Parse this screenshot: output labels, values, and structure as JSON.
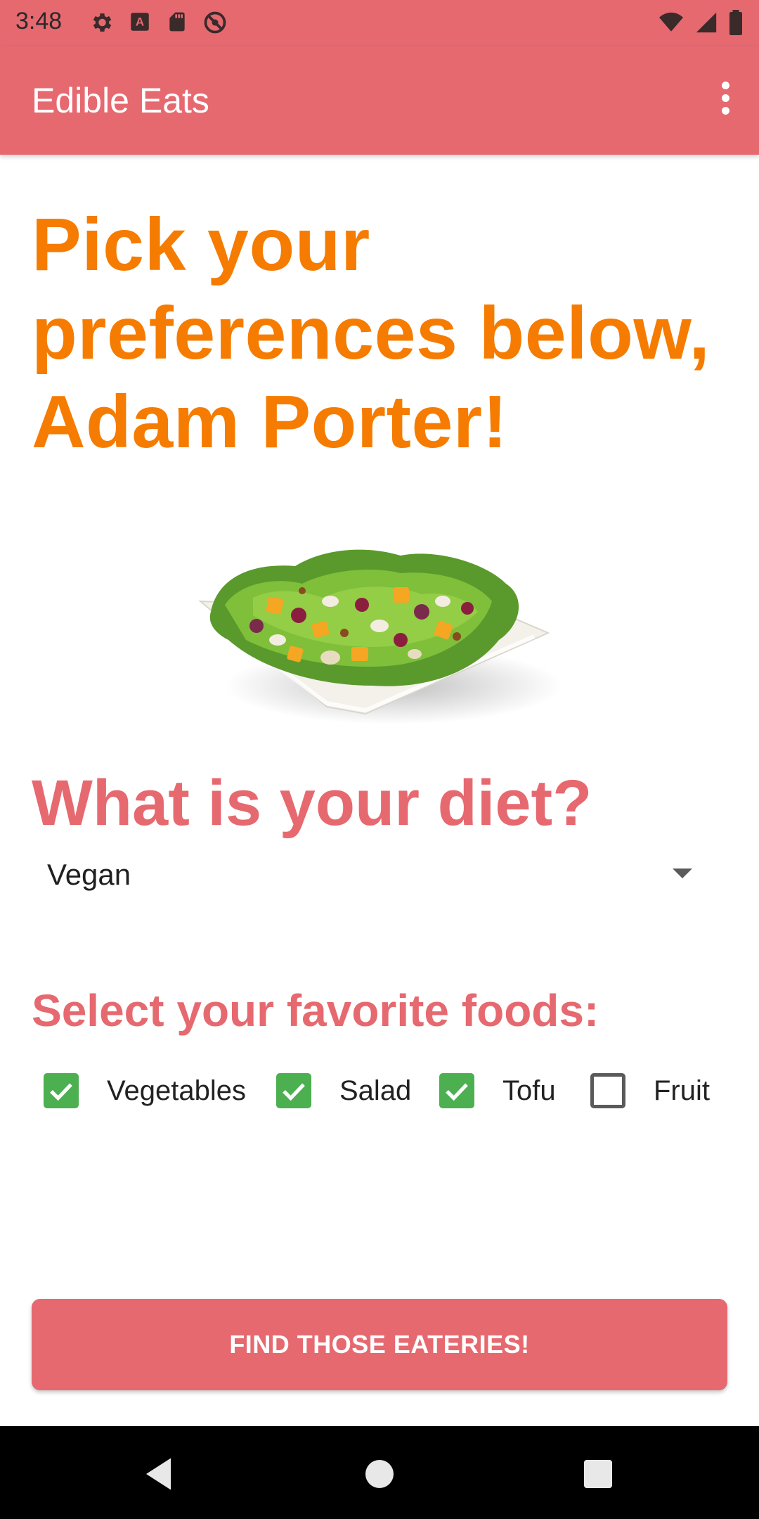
{
  "status_bar": {
    "time": "3:48",
    "icons_left": [
      "gear-icon",
      "text-a-icon",
      "sd-card-icon",
      "no-sync-icon"
    ],
    "icons_right": [
      "wifi-icon",
      "signal-icon",
      "battery-icon"
    ]
  },
  "app_bar": {
    "title": "Edible Eats",
    "overflow_icon": "more-vert-icon"
  },
  "main": {
    "headline": "Pick your preferences below, Adam Porter!",
    "image_subject": "salad",
    "diet_question": "What is your diet?",
    "diet_selected": "Vegan",
    "foods_question": "Select your favorite foods:",
    "foods": [
      {
        "label": "Vegetables",
        "checked": true
      },
      {
        "label": "Salad",
        "checked": true
      },
      {
        "label": "Tofu",
        "checked": true
      },
      {
        "label": "Fruit",
        "checked": false
      }
    ],
    "cta_label": "FIND THOSE EATERIES!"
  },
  "nav": {
    "buttons": [
      "back-icon",
      "home-icon",
      "recents-icon"
    ]
  },
  "colors": {
    "primary": "#e66970",
    "headline": "#f57c00",
    "check": "#4caf50"
  }
}
